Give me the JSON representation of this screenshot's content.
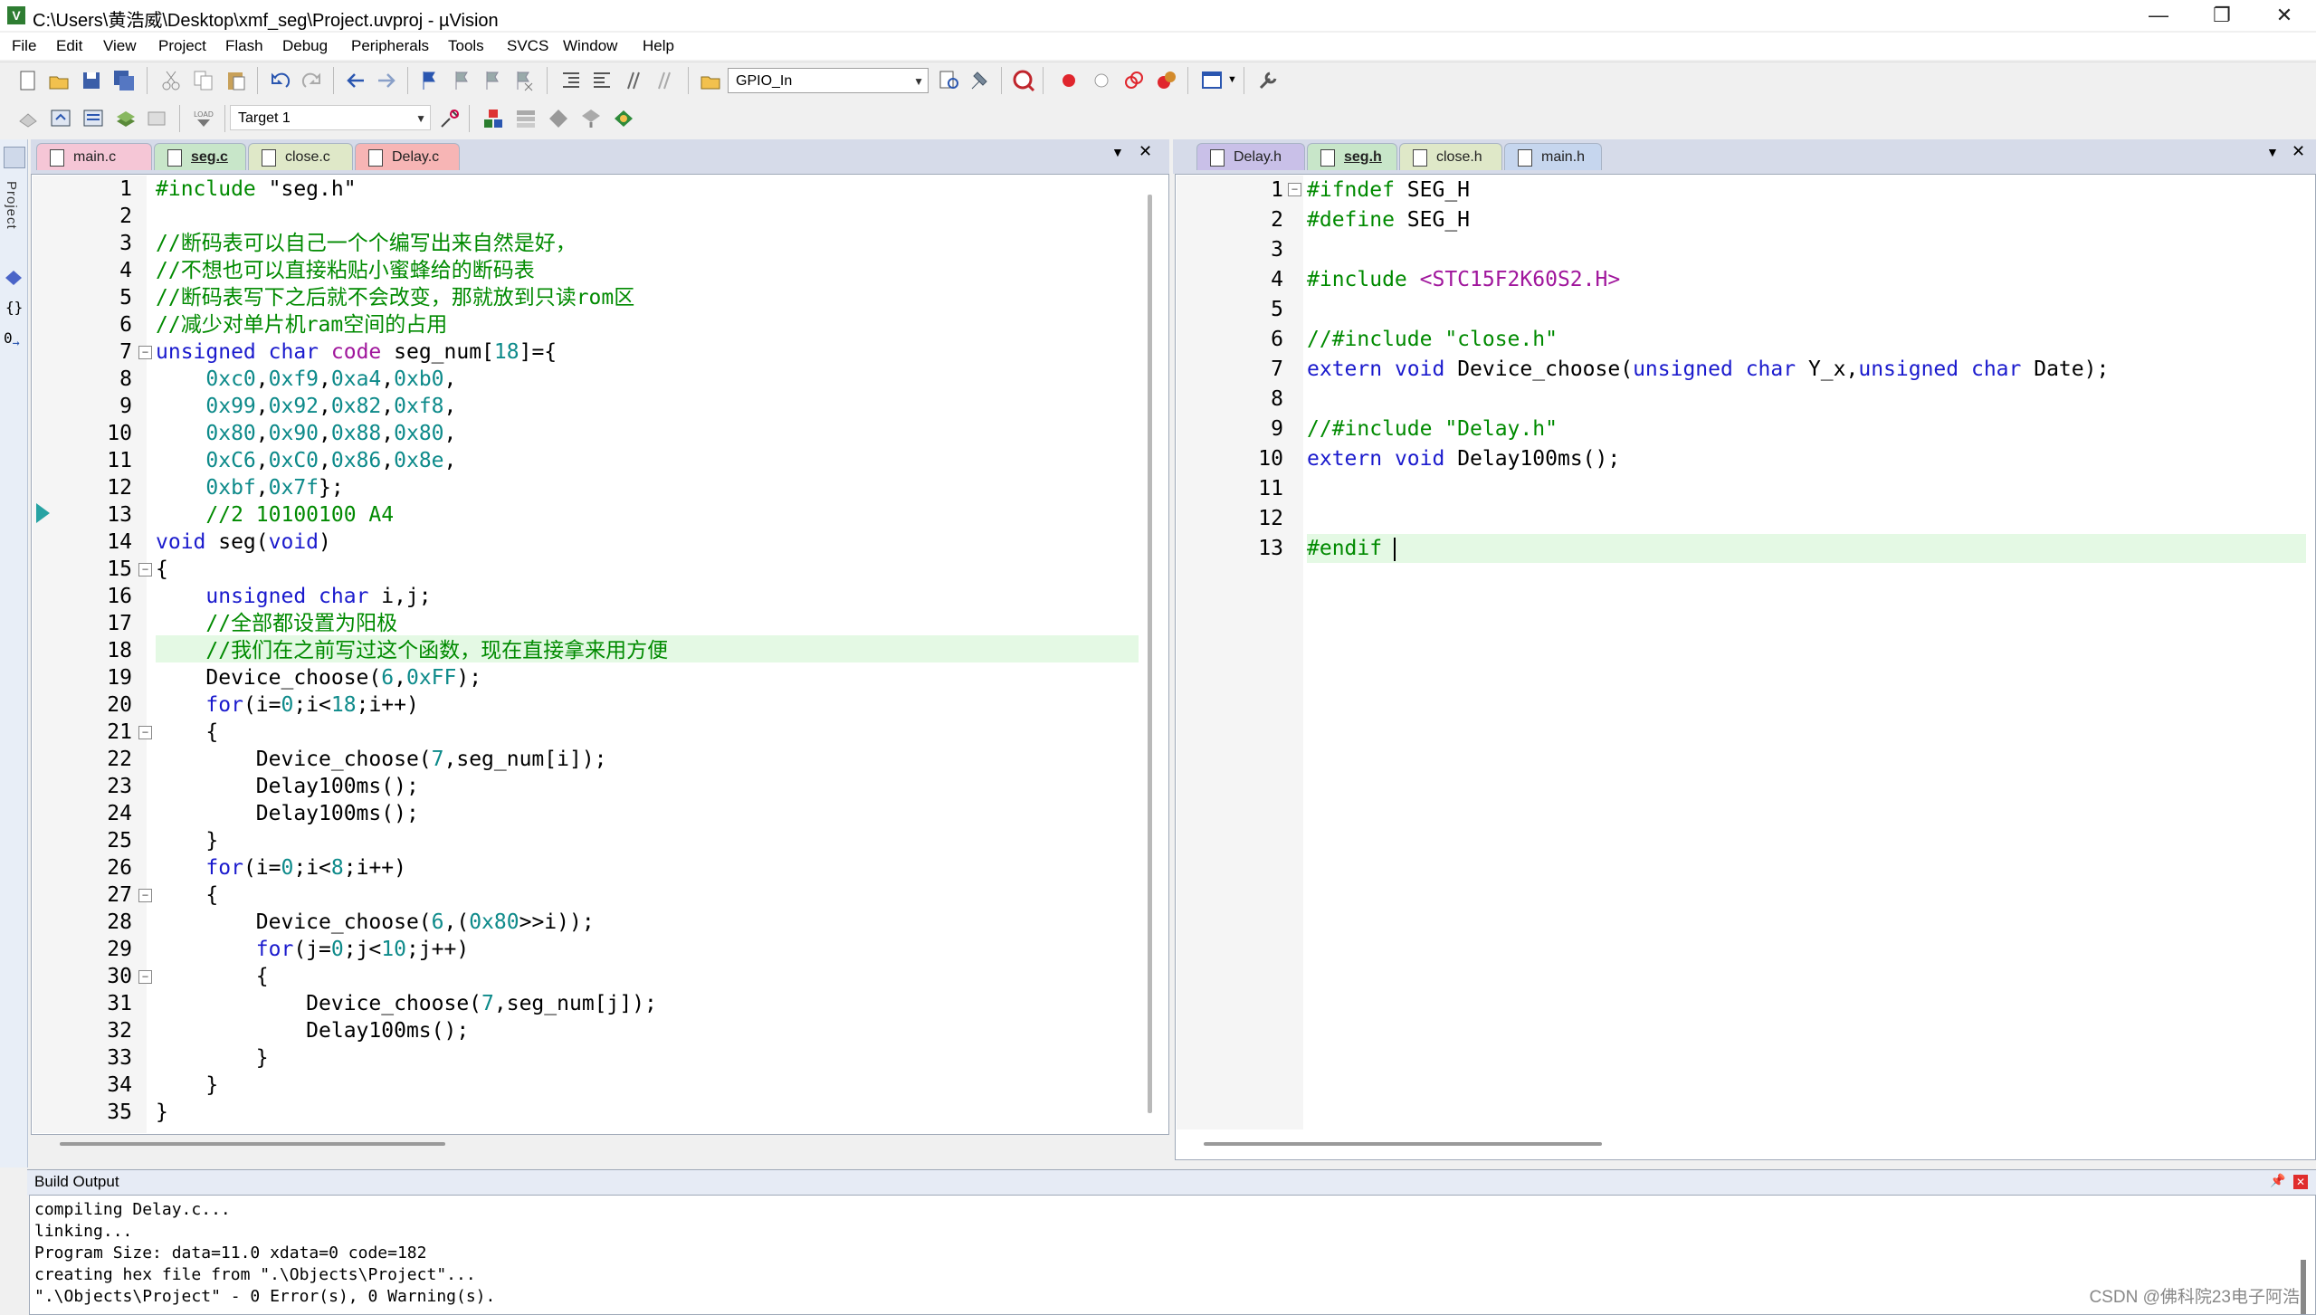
{
  "window": {
    "title": "C:\\Users\\黄浩威\\Desktop\\xmf_seg\\Project.uvproj - µVision",
    "minimize": "—",
    "maximize": "❐",
    "close": "✕"
  },
  "menu": [
    "File",
    "Edit",
    "View",
    "Project",
    "Flash",
    "Debug",
    "Peripherals",
    "Tools",
    "SVCS",
    "Window",
    "Help"
  ],
  "toolbar": {
    "find_combo": "GPIO_In",
    "target_combo": "Target 1"
  },
  "sidebar": {
    "label": "Project"
  },
  "left_editor": {
    "tabs": [
      {
        "label": "main.c",
        "color": "#f5c6d6"
      },
      {
        "label": "seg.c",
        "color": "#c8e6c9",
        "active": true
      },
      {
        "label": "close.c",
        "color": "#dfe8c8"
      },
      {
        "label": "Delay.c",
        "color": "#f7b5b5"
      }
    ],
    "lines": [
      "1",
      "2",
      "3",
      "4",
      "5",
      "6",
      "7",
      "8",
      "9",
      "10",
      "11",
      "12",
      "13",
      "14",
      "15",
      "16",
      "17",
      "18",
      "19",
      "20",
      "21",
      "22",
      "23",
      "24",
      "25",
      "26",
      "27",
      "28",
      "29",
      "30",
      "31",
      "32",
      "33",
      "34",
      "35"
    ],
    "code": [
      "#include \"seg.h\"",
      "",
      "//断码表可以自己一个个编写出来自然是好，",
      "//不想也可以直接粘贴小蜜蜂给的断码表",
      "//断码表写下之后就不会改变，那就放到只读rom区",
      "//减少对单片机ram空间的占用",
      "unsigned char code seg_num[18]={",
      "    0xc0,0xf9,0xa4,0xb0,",
      "    0x99,0x92,0x82,0xf8,",
      "    0x80,0x90,0x88,0x80,",
      "    0xC6,0xC0,0x86,0x8e,",
      "    0xbf,0x7f};",
      "    //2 10100100 A4",
      "void seg(void)",
      "{",
      "    unsigned char i,j;",
      "    //全部都设置为阳极",
      "    //我们在之前写过这个函数，现在直接拿来用方便",
      "    Device_choose(6,0xFF);",
      "    for(i=0;i<18;i++)",
      "    {",
      "        Device_choose(7,seg_num[i]);",
      "        Delay100ms();",
      "        Delay100ms();",
      "    }",
      "    for(i=0;i<8;i++)",
      "    {",
      "        Device_choose(6,(0x80>>i));",
      "        for(j=0;j<10;j++)",
      "        {",
      "            Device_choose(7,seg_num[j]);",
      "            Delay100ms();",
      "        }",
      "    }",
      "}"
    ]
  },
  "right_editor": {
    "tabs": [
      {
        "label": "Delay.h",
        "color": "#c9c0e8"
      },
      {
        "label": "seg.h",
        "color": "#c8e6c9",
        "active": true
      },
      {
        "label": "close.h",
        "color": "#dfe8c8"
      },
      {
        "label": "main.h",
        "color": "#c6d6ee"
      }
    ],
    "lines": [
      "1",
      "2",
      "3",
      "4",
      "5",
      "6",
      "7",
      "8",
      "9",
      "10",
      "11",
      "12",
      "13"
    ],
    "code": [
      "#ifndef SEG_H",
      "#define SEG_H",
      "",
      "#include <STC15F2K60S2.H>",
      "",
      "//#include \"close.h\"",
      "extern void Device_choose(unsigned char Y_x,unsigned char Date);",
      "",
      "//#include \"Delay.h\"",
      "extern void Delay100ms();",
      "",
      "",
      "#endif"
    ]
  },
  "build_output": {
    "title": "Build Output",
    "lines": [
      "compiling Delay.c...",
      "linking...",
      "Program Size: data=11.0 xdata=0 code=182",
      "creating hex file from \".\\Objects\\Project\"...",
      "\".\\Objects\\Project\" - 0 Error(s), 0 Warning(s)."
    ]
  },
  "watermark": "CSDN @佛科院23电子阿浩"
}
